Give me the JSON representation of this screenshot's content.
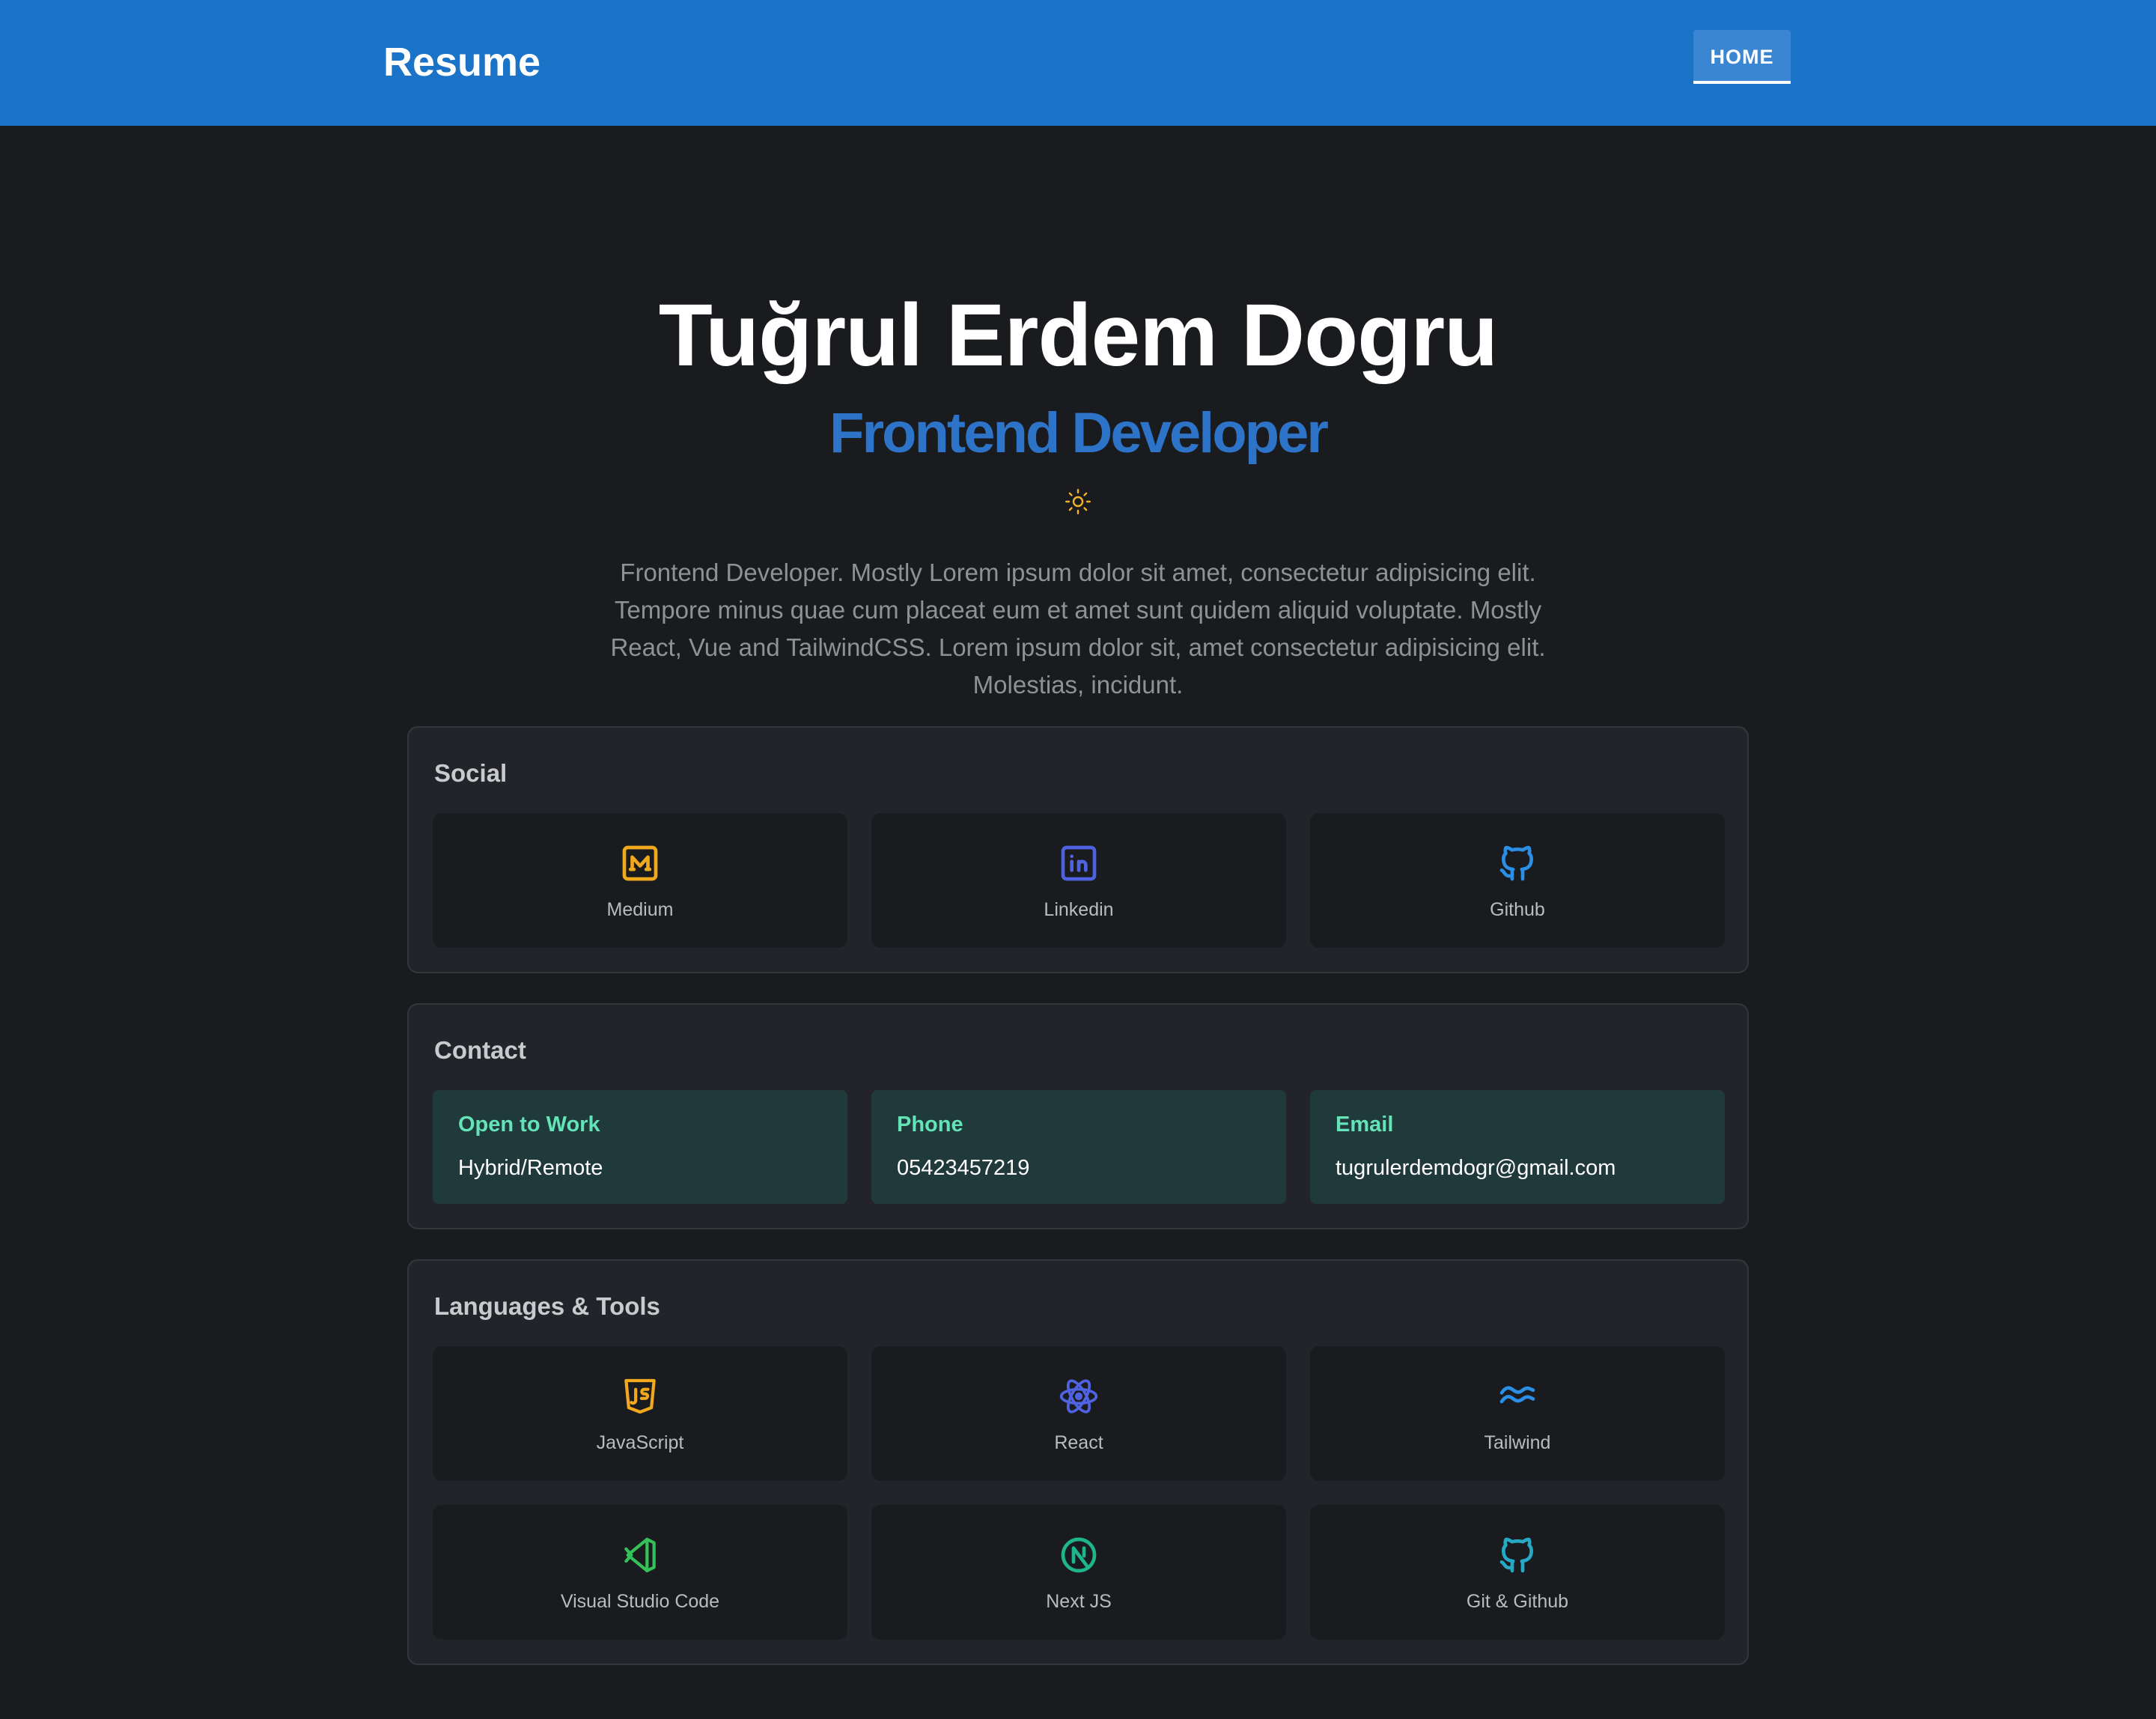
{
  "header": {
    "brand": "Resume",
    "nav_home": "HOME"
  },
  "hero": {
    "name": "Tuğrul Erdem Dogru",
    "role": "Frontend Developer",
    "bio": "Frontend Developer. Mostly Lorem ipsum dolor sit amet, consectetur adipisicing elit. Tempore minus quae cum placeat eum et amet sunt quidem aliquid voluptate. Mostly React, Vue and TailwindCSS. Lorem ipsum dolor sit, amet consectetur adipisicing elit. Molestias, incidunt."
  },
  "social": {
    "title": "Social",
    "items": [
      {
        "label": "Medium",
        "icon": "medium-icon",
        "color": "#f0a81c"
      },
      {
        "label": "Linkedin",
        "icon": "linkedin-icon",
        "color": "#4f62e0"
      },
      {
        "label": "Github",
        "icon": "github-icon",
        "color": "#2b8fe6"
      }
    ]
  },
  "contact": {
    "title": "Contact",
    "items": [
      {
        "title": "Open to Work",
        "value": "Hybrid/Remote"
      },
      {
        "title": "Phone",
        "value": "05423457219"
      },
      {
        "title": "Email",
        "value": "tugrulerdemdogr@gmail.com"
      }
    ]
  },
  "tools": {
    "title": "Languages & Tools",
    "items": [
      {
        "label": "JavaScript",
        "icon": "javascript-icon",
        "color": "#f0a81c"
      },
      {
        "label": "React",
        "icon": "react-icon",
        "color": "#4f62e0"
      },
      {
        "label": "Tailwind",
        "icon": "tailwind-icon",
        "color": "#2b8fe6"
      },
      {
        "label": "Visual Studio Code",
        "icon": "vscode-icon",
        "color": "#35c15a"
      },
      {
        "label": "Next JS",
        "icon": "nextjs-icon",
        "color": "#1fb58a"
      },
      {
        "label": "Git & Github",
        "icon": "github-icon",
        "color": "#26a9c4"
      }
    ]
  },
  "colors": {
    "header_bg": "#1b73c7",
    "page_bg": "#1a1b1f",
    "accent_role": "#2d73c8",
    "sun": "#f0b429",
    "contact_title": "#64e3b7"
  }
}
